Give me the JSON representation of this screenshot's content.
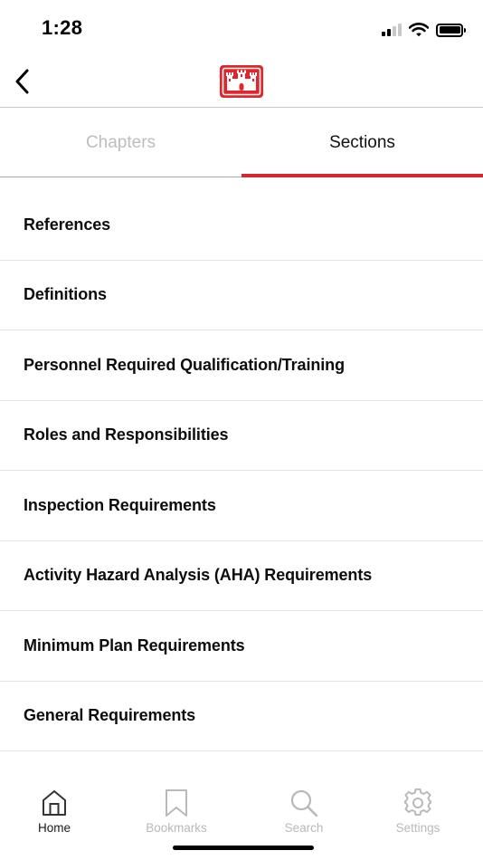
{
  "status_bar": {
    "time": "1:28",
    "icons": [
      "cellular-signal-icon",
      "wifi-icon",
      "battery-icon"
    ]
  },
  "nav": {
    "back_icon": "chevron-left-icon",
    "logo_icon": "castle-logo-icon"
  },
  "tabs": [
    {
      "label": "Chapters",
      "active": false
    },
    {
      "label": "Sections",
      "active": true
    }
  ],
  "sections": [
    {
      "label": "References"
    },
    {
      "label": "Definitions"
    },
    {
      "label": "Personnel Required Qualification/Training"
    },
    {
      "label": "Roles and Responsibilities"
    },
    {
      "label": "Inspection Requirements"
    },
    {
      "label": "Activity Hazard Analysis (AHA) Requirements"
    },
    {
      "label": "Minimum Plan Requirements"
    },
    {
      "label": "General Requirements"
    }
  ],
  "bottom_nav": [
    {
      "label": "Home",
      "icon": "home-icon",
      "active": true
    },
    {
      "label": "Bookmarks",
      "icon": "bookmark-icon",
      "active": false
    },
    {
      "label": "Search",
      "icon": "search-icon",
      "active": false
    },
    {
      "label": "Settings",
      "icon": "gear-icon",
      "active": false
    }
  ],
  "colors": {
    "accent": "#d9262a",
    "inactive": "#bdbdbd",
    "text": "#0d0d0d"
  }
}
